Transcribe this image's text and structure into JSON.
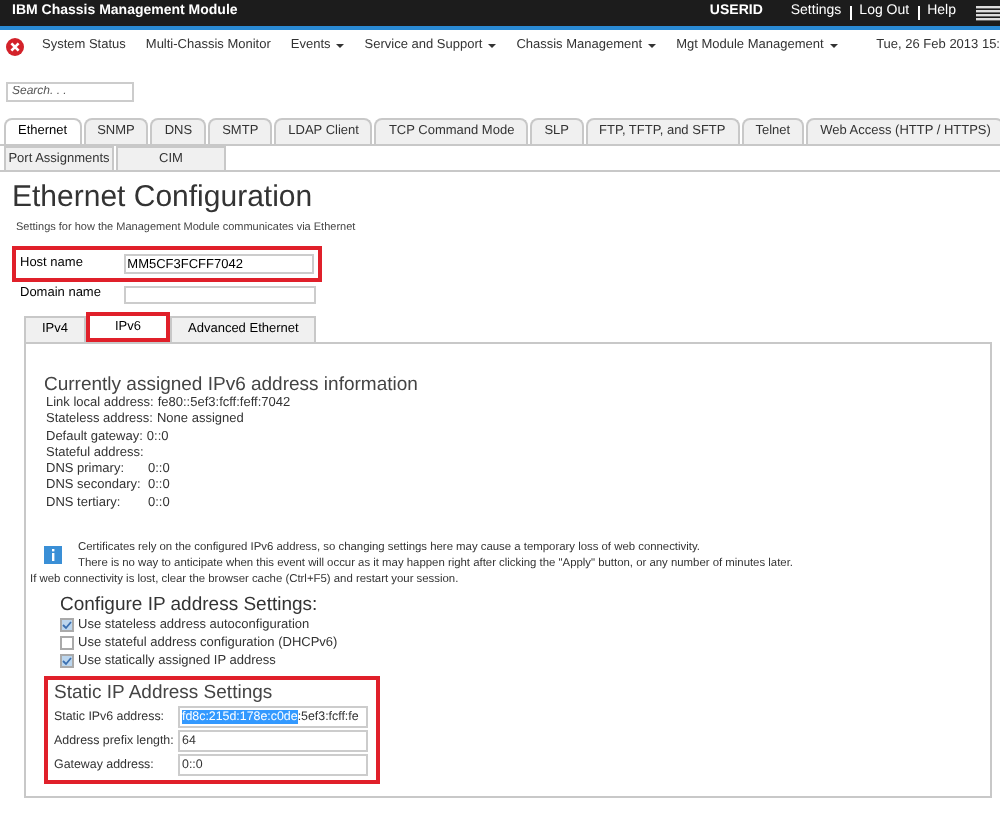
{
  "header": {
    "title": "IBM Chassis Management Module",
    "user": "USERID",
    "links": [
      "Settings",
      "Log Out",
      "Help"
    ]
  },
  "nav": {
    "items": [
      {
        "label": "System Status",
        "has_menu": false
      },
      {
        "label": "Multi-Chassis Monitor",
        "has_menu": false
      },
      {
        "label": "Events",
        "has_menu": true
      },
      {
        "label": "Service and Support",
        "has_menu": true
      },
      {
        "label": "Chassis Management",
        "has_menu": true
      },
      {
        "label": "Mgt Module Management",
        "has_menu": true
      }
    ],
    "datetime": "Tue, 26 Feb 2013 15:",
    "search": {
      "placeholder": "Search. . ."
    }
  },
  "tabs": [
    {
      "label": "Ethernet",
      "selected": true
    },
    {
      "label": "SNMP",
      "selected": false
    },
    {
      "label": "DNS",
      "selected": false
    },
    {
      "label": "SMTP",
      "selected": false
    },
    {
      "label": "LDAP Client",
      "selected": false
    },
    {
      "label": "TCP Command Mode",
      "selected": false
    },
    {
      "label": "SLP",
      "selected": false
    },
    {
      "label": "FTP, TFTP, and SFTP",
      "selected": false
    },
    {
      "label": "Telnet",
      "selected": false
    },
    {
      "label": "Web Access (HTTP / HTTPS)",
      "selected": false
    },
    {
      "label": "Port Assignments",
      "selected": false
    },
    {
      "label": "CIM",
      "selected": false
    }
  ],
  "page": {
    "title": "Ethernet Configuration",
    "subtitle": "Settings for how the Management Module communicates via Ethernet",
    "host_name": {
      "label": "Host name",
      "value": "MM5CF3FCFF7042"
    },
    "domain_name": {
      "label": "Domain name"
    }
  },
  "sub_tabs": [
    {
      "label": "IPv4",
      "selected": false
    },
    {
      "label": "IPv6",
      "selected": true
    },
    {
      "label": "Advanced Ethernet",
      "selected": false
    }
  ],
  "current": {
    "title": "Currently assigned IPv6 address information",
    "rows": [
      {
        "label": "Link local address:",
        "value": "fe80::5ef3:fcff:feff:7042"
      },
      {
        "label": "Stateless address:",
        "value": "None assigned"
      },
      {
        "label": "Default gateway:",
        "value": "0::0"
      },
      {
        "label": "Stateful address:"
      },
      {
        "label": "DNS primary:",
        "value": "0::0"
      },
      {
        "label": "DNS secondary:",
        "value": "0::0"
      },
      {
        "label": "DNS tertiary:",
        "value": "0::0"
      }
    ]
  },
  "notice": {
    "lines": [
      "Certificates rely on the configured IPv6 address, so changing settings here may cause a temporary loss of web connectivity.",
      "There is no way to anticipate when this event will occur as it may happen right after clicking the \"Apply\" button, or any number of minutes later."
    ],
    "footer": "If web connectivity is lost, clear the browser cache (Ctrl+F5) and restart your session."
  },
  "configure": {
    "title": "Configure IP address Settings:",
    "options": [
      {
        "label": "Use stateless address autoconfiguration",
        "checked": true
      },
      {
        "label": "Use stateful address configuration (DHCPv6)",
        "checked": false
      },
      {
        "label": "Use statically assigned IP address",
        "checked": true
      }
    ]
  },
  "static": {
    "title": "Static IP Address Settings",
    "fields": [
      {
        "label": "Static IPv6 address:",
        "value_selected": "fd8c:215d:178e:c0de",
        "value_rest": ":5ef3:fcff:fe"
      },
      {
        "label": "Address prefix length:",
        "value_rest": "64"
      },
      {
        "label": "Gateway address:",
        "value_rest": "0::0"
      }
    ]
  }
}
